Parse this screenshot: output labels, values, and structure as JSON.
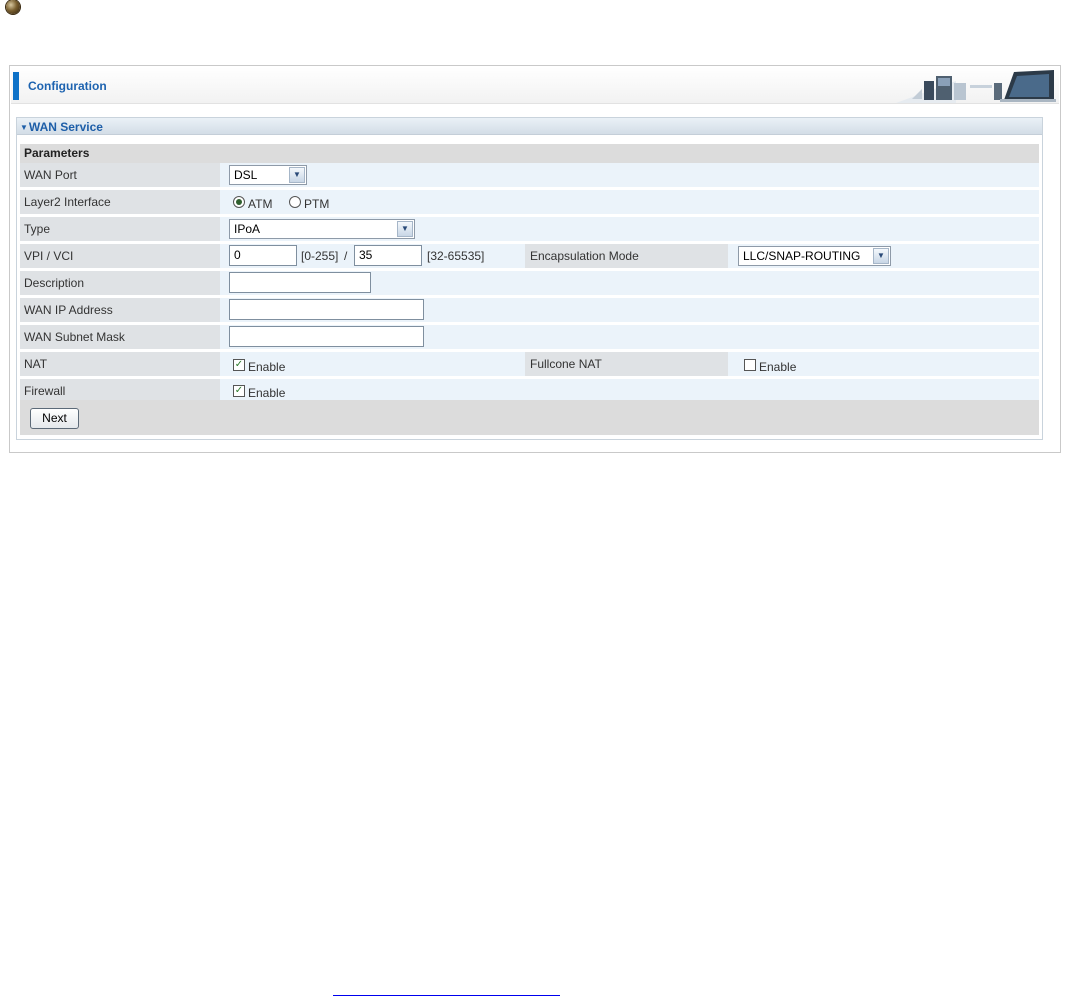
{
  "panel": {
    "title": "Configuration"
  },
  "wan_service": {
    "title": "WAN Service",
    "params_header": "Parameters"
  },
  "fields": {
    "wan_port": {
      "label": "WAN Port",
      "value": "DSL"
    },
    "layer2": {
      "label": "Layer2 Interface",
      "options": [
        "ATM",
        "PTM"
      ],
      "selected": "ATM"
    },
    "type": {
      "label": "Type",
      "value": "IPoA"
    },
    "vpi_vci": {
      "label": "VPI / VCI",
      "vpi": "0",
      "vpi_range": "[0-255]",
      "sep": "/",
      "vci": "35",
      "vci_range": "[32-65535]"
    },
    "encapsulation": {
      "label": "Encapsulation Mode",
      "value": "LLC/SNAP-ROUTING"
    },
    "description": {
      "label": "Description",
      "value": ""
    },
    "wan_ip": {
      "label": "WAN IP Address",
      "value": ""
    },
    "wan_mask": {
      "label": "WAN Subnet Mask",
      "value": ""
    },
    "nat": {
      "label": "NAT",
      "option": "Enable",
      "checked": true
    },
    "fullcone_nat": {
      "label": "Fullcone NAT",
      "option": "Enable",
      "checked": false
    },
    "firewall": {
      "label": "Firewall",
      "option": "Enable",
      "checked": true
    }
  },
  "buttons": {
    "next": "Next"
  },
  "icons": {
    "bullet": "bullet-icon",
    "header_art": "network-devices-icon",
    "collapse": "triangle-down-icon",
    "dropdown": "chevron-down-icon",
    "checkmark": "checkmark-icon"
  }
}
